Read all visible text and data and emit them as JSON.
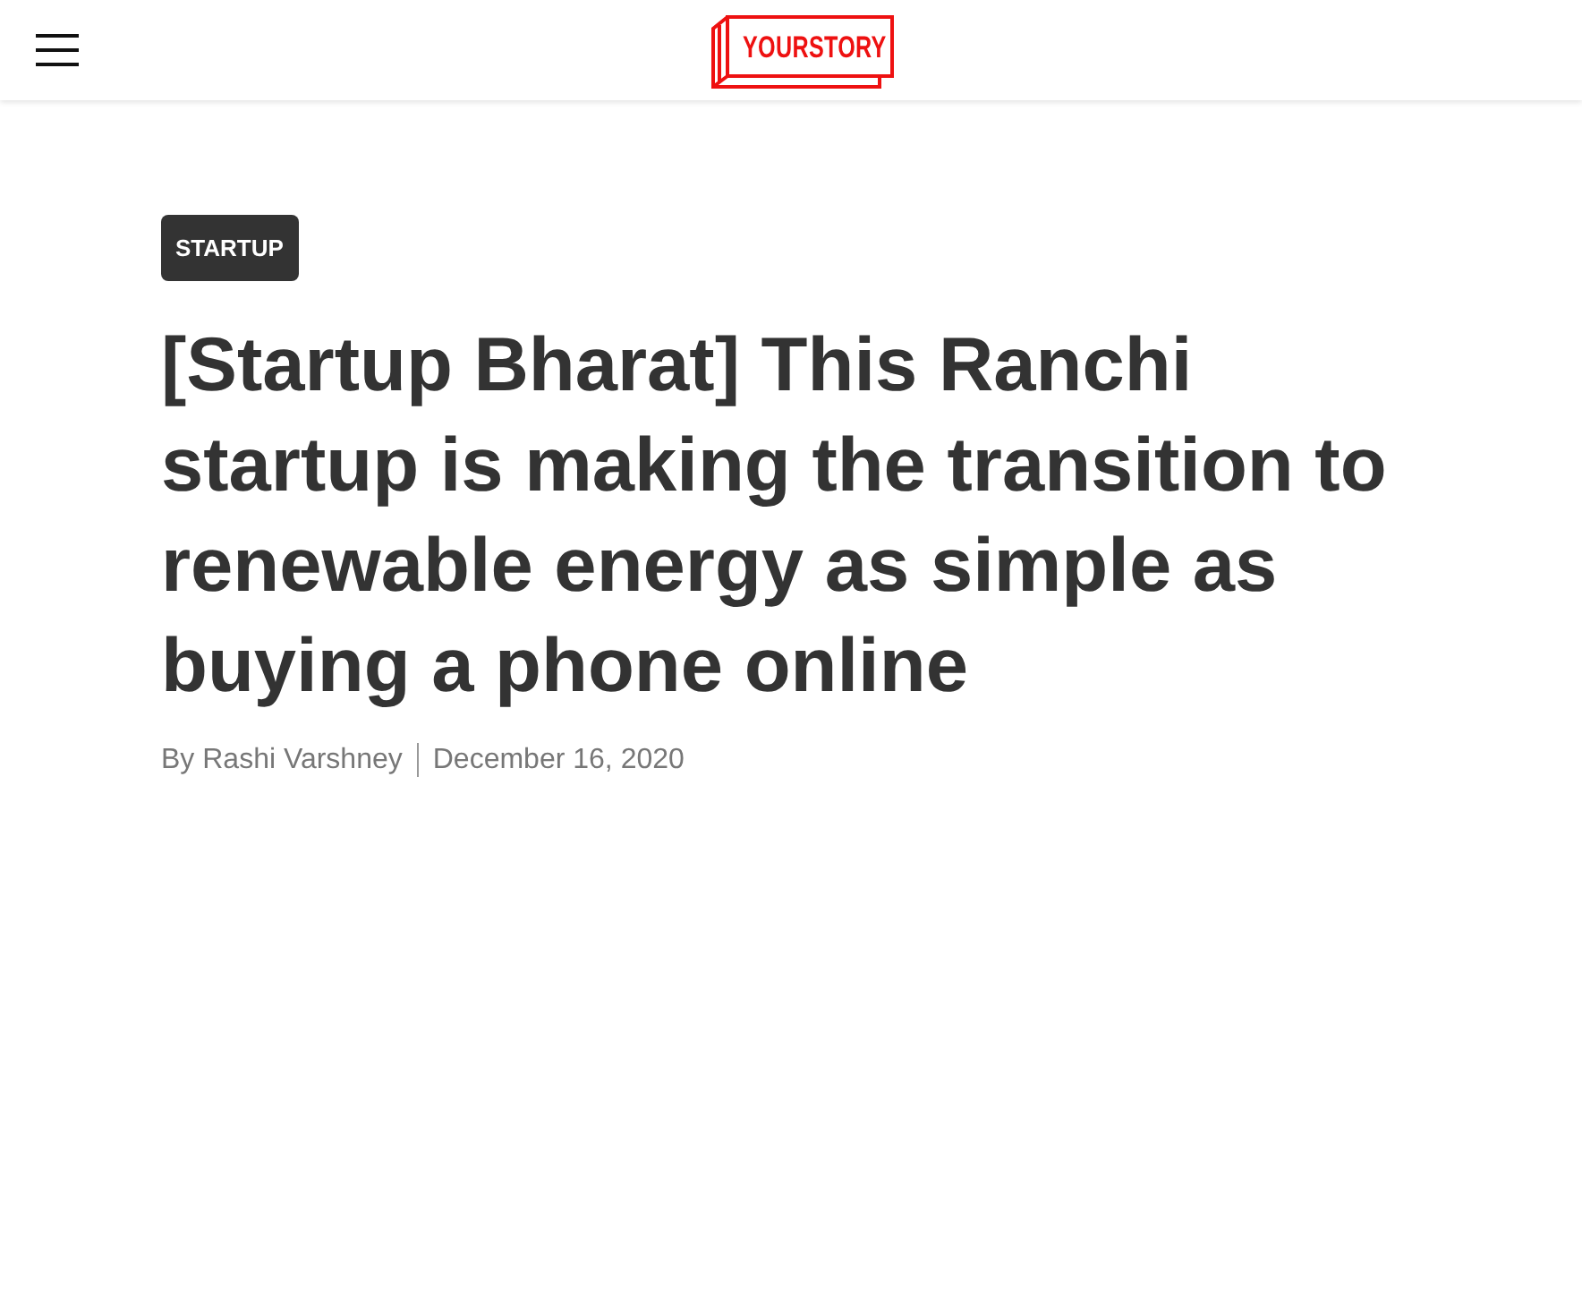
{
  "header": {
    "logo": {
      "text": "YOURSTORY"
    }
  },
  "article": {
    "category": "STARTUP",
    "title": "[Startup Bharat] This Ranchi startup is making the transition to renewable energy as simple as buying a phone online",
    "author": "By Rashi Varshney",
    "date": "December 16, 2020"
  }
}
